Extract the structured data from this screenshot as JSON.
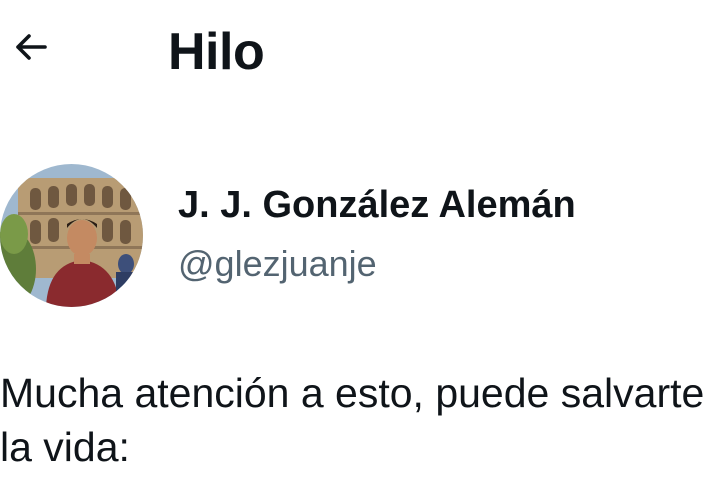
{
  "header": {
    "back_icon": "arrow-left-icon",
    "title": "Hilo"
  },
  "author": {
    "name": "J. J. González Alemán",
    "handle": "@glezjuanje",
    "avatar_icon": "avatar-photo"
  },
  "tweet": {
    "text": "Mucha atención a esto, puede salvarte la vida:"
  },
  "colors": {
    "text_primary": "#0f1419",
    "text_secondary": "#536471",
    "background": "#ffffff"
  }
}
